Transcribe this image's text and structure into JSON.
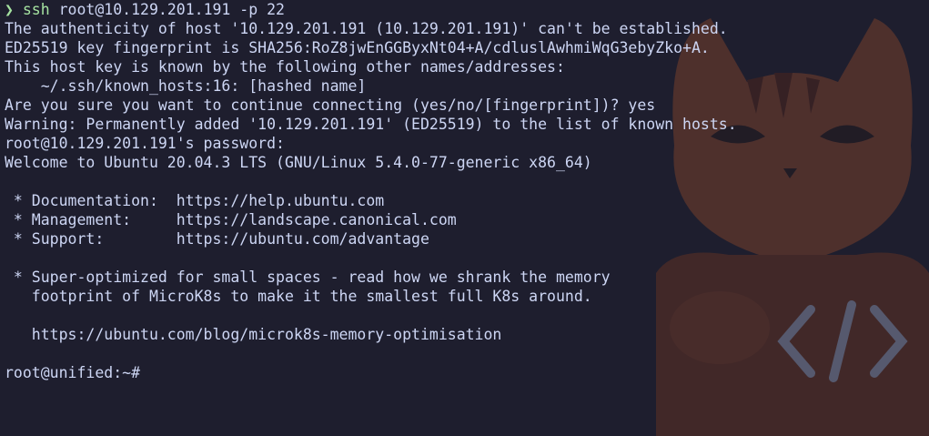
{
  "window": {
    "accent": "#a6e3a1",
    "background": "#1e1e2e",
    "foreground": "#cdd6f4"
  },
  "command": {
    "prompt_symbol": "❯",
    "name": "ssh",
    "args": "root@10.129.201.191 -p 22"
  },
  "output": [
    "The authenticity of host '10.129.201.191 (10.129.201.191)' can't be established.",
    "ED25519 key fingerprint is SHA256:RoZ8jwEnGGByxNt04+A/cdluslAwhmiWqG3ebyZko+A.",
    "This host key is known by the following other names/addresses:",
    "    ~/.ssh/known_hosts:16: [hashed name]",
    "Are you sure you want to continue connecting (yes/no/[fingerprint])? yes",
    "Warning: Permanently added '10.129.201.191' (ED25519) to the list of known hosts.",
    "root@10.129.201.191's password:",
    "Welcome to Ubuntu 20.04.3 LTS (GNU/Linux 5.4.0-77-generic x86_64)",
    "",
    " * Documentation:  https://help.ubuntu.com",
    " * Management:     https://landscape.canonical.com",
    " * Support:        https://ubuntu.com/advantage",
    "",
    " * Super-optimized for small spaces - read how we shrank the memory",
    "   footprint of MicroK8s to make it the smallest full K8s around.",
    "",
    "   https://ubuntu.com/blog/microk8s-memory-optimisation",
    ""
  ],
  "final_prompt": "root@unified:~#",
  "background_art": "cat-mascot-with-code-brackets"
}
